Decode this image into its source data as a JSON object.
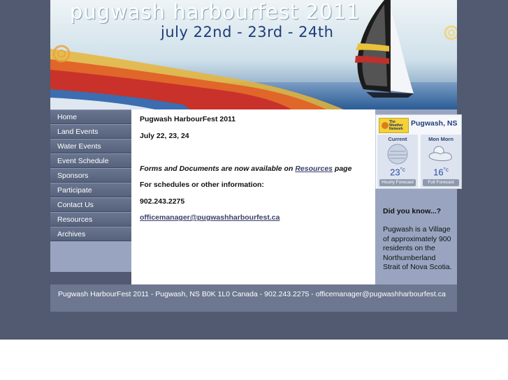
{
  "banner": {
    "title": "pugwash harbourfest 2011",
    "dates": "july 22nd - 23rd - 24th"
  },
  "nav": {
    "items": [
      "Home",
      "Land Events",
      "Water Events",
      "Event Schedule",
      "Sponsors",
      "Participate",
      "Contact Us",
      "Resources",
      "Archives"
    ]
  },
  "content": {
    "heading": "Pugwash HarbourFest 2011",
    "dates": "July 22, 23, 24",
    "forms_before": "Forms and Documents are now available on ",
    "forms_link": "Resources",
    "forms_after": " page",
    "schedules": "For schedules or other information:",
    "phone": "902.243.2275",
    "email": "officemanager@pugwashharbourfest.ca"
  },
  "weather": {
    "location": "Pugwash, NS",
    "logo_text": "The Weather Network",
    "current_label": "Current",
    "current_temp": "23",
    "forecast_label": "Mon Morn",
    "forecast_temp": "16",
    "unit": "°c",
    "hourly_button": "Hourly Forecast",
    "full_button": "Full Forecast",
    "current_icon": "cloudy-icon",
    "forecast_icon": "partly-cloudy-icon"
  },
  "did_you_know": {
    "title": "Did you know...?",
    "text": "Pugwash is a Village of approximately 900 residents on the Northumberland Strait of Nova Scotia."
  },
  "footer": {
    "text": "Pugwash HarbourFest 2011 - Pugwash, NS B0K 1L0 Canada - 902.243.2275 - officemanager@pugwashharbourfest.ca"
  },
  "colors": {
    "page_background": "#515a70",
    "nav_item": "#5f6b85",
    "sidebar": "#99a5c0",
    "footer": "#6d7790"
  }
}
